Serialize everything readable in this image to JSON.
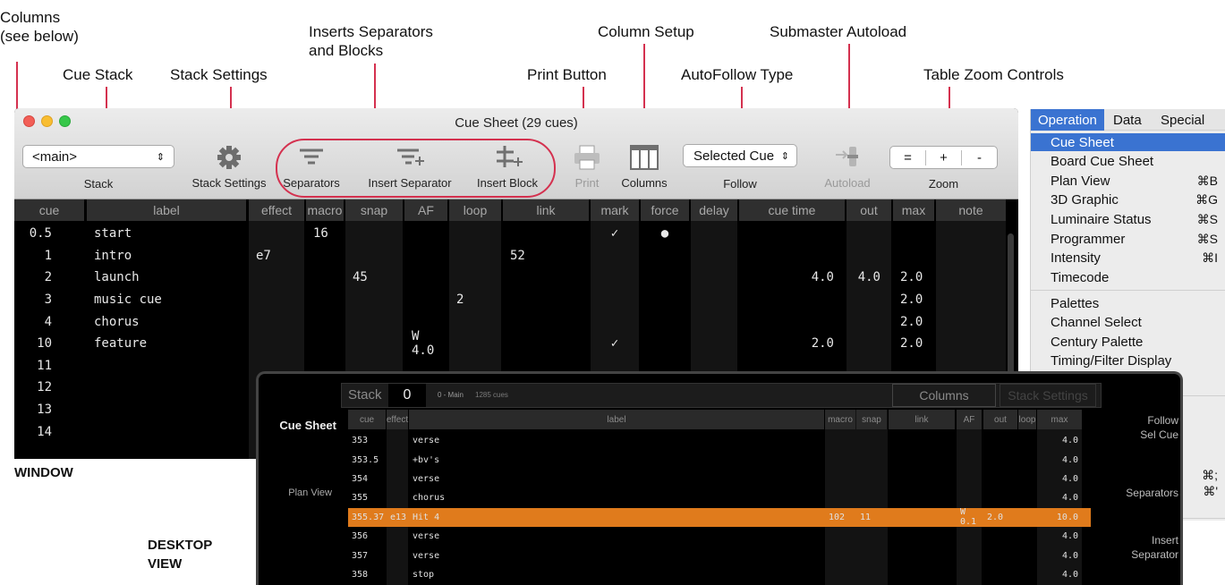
{
  "callouts": {
    "columns": "Columns\n(see below)",
    "cue_stack": "Cue Stack",
    "stack_settings": "Stack Settings",
    "inserts": "Inserts Separators\nand Blocks",
    "column_setup": "Column Setup",
    "submaster_autoload": "Submaster Autoload",
    "print_button": "Print Button",
    "autofollow_type": "AutoFollow Type",
    "table_zoom": "Table Zoom Controls",
    "window": "WINDOW",
    "desktop_view": "DESKTOP\nVIEW"
  },
  "colors": {
    "callout_line": "#d4314f",
    "highlight_row": "#e07b1c",
    "menu_selected": "#3a73d1"
  },
  "window": {
    "title": "Cue Sheet (29 cues)",
    "toolbar": {
      "stack_value": "<main>",
      "stack_label": "Stack",
      "stack_settings_label": "Stack Settings",
      "separators_label": "Separators",
      "insert_separator_label": "Insert Separator",
      "insert_block_label": "Insert Block",
      "print_label": "Print",
      "columns_label": "Columns",
      "follow_value": "Selected Cue",
      "follow_label": "Follow",
      "autoload_label": "Autoload",
      "zoom_label": "Zoom",
      "zoom_buttons": [
        "=",
        "+",
        "-"
      ],
      "icons": [
        "gear-icon",
        "separators-icon",
        "insert-separator-icon",
        "insert-block-icon",
        "printer-icon",
        "columns-icon",
        "autoload-icon"
      ]
    },
    "columns": [
      "cue",
      "label",
      "effect",
      "macro",
      "snap",
      "AF",
      "loop",
      "link",
      "mark",
      "force",
      "delay",
      "cue time",
      "out",
      "max",
      "note"
    ],
    "rows": [
      {
        "cue": "0.5",
        "label": "start",
        "effect": "",
        "macro": "16",
        "snap": "",
        "af": "",
        "loop": "",
        "link": "",
        "mark": "✓",
        "force": "●",
        "cuetime": "",
        "out": "",
        "max": ""
      },
      {
        "cue": "1",
        "label": "intro",
        "effect": "e7",
        "macro": "",
        "snap": "",
        "af": "",
        "loop": "",
        "link": "52",
        "mark": "",
        "force": "",
        "cuetime": "",
        "out": "",
        "max": ""
      },
      {
        "cue": "2",
        "label": "launch",
        "effect": "",
        "macro": "",
        "snap": "45",
        "af": "",
        "loop": "",
        "link": "",
        "mark": "",
        "force": "",
        "cuetime": "4.0",
        "out": "4.0",
        "max": "2.0"
      },
      {
        "cue": "3",
        "label": "music cue",
        "effect": "",
        "macro": "",
        "snap": "",
        "af": "",
        "loop": "2",
        "link": "",
        "mark": "",
        "force": "",
        "cuetime": "",
        "out": "",
        "max": "2.0"
      },
      {
        "cue": "4",
        "label": "chorus",
        "effect": "",
        "macro": "",
        "snap": "",
        "af": "",
        "loop": "",
        "link": "",
        "mark": "",
        "force": "",
        "cuetime": "",
        "out": "",
        "max": "2.0"
      },
      {
        "cue": "10",
        "label": "feature",
        "effect": "",
        "macro": "",
        "snap": "",
        "af": "W 4.0",
        "loop": "",
        "link": "",
        "mark": "✓",
        "force": "",
        "cuetime": "2.0",
        "out": "",
        "max": "2.0"
      },
      {
        "cue": "11",
        "label": "",
        "effect": "",
        "macro": "",
        "snap": "",
        "af": "",
        "loop": "",
        "link": "",
        "mark": "",
        "force": "",
        "cuetime": "",
        "out": "",
        "max": ""
      },
      {
        "cue": "12",
        "label": "",
        "effect": "",
        "macro": "",
        "snap": "",
        "af": "",
        "loop": "",
        "link": "",
        "mark": "",
        "force": "",
        "cuetime": "",
        "out": "",
        "max": ""
      },
      {
        "cue": "13",
        "label": "",
        "effect": "",
        "macro": "",
        "snap": "",
        "af": "",
        "loop": "",
        "link": "",
        "mark": "",
        "force": "",
        "cuetime": "",
        "out": "",
        "max": ""
      },
      {
        "cue": "14",
        "label": "",
        "effect": "",
        "macro": "",
        "snap": "",
        "af": "",
        "loop": "",
        "link": "",
        "mark": "",
        "force": "",
        "cuetime": "",
        "out": "",
        "max": ""
      }
    ]
  },
  "menu": {
    "bar": [
      "Operation",
      "Data",
      "Special"
    ],
    "items": [
      {
        "label": "Cue Sheet",
        "shortcut": ""
      },
      {
        "label": "Board Cue Sheet",
        "shortcut": ""
      },
      {
        "label": "Plan View",
        "shortcut": "⌘B"
      },
      {
        "label": "3D Graphic",
        "shortcut": "⌘G"
      },
      {
        "label": "Luminaire Status",
        "shortcut": "⌘S"
      },
      {
        "label": "Programmer",
        "shortcut": "⌘S"
      },
      {
        "label": "Intensity",
        "shortcut": "⌘I"
      },
      {
        "label": "Timecode",
        "shortcut": ""
      }
    ],
    "items2": [
      {
        "label": "Palettes"
      },
      {
        "label": "Channel Select"
      },
      {
        "label": "Century Palette"
      },
      {
        "label": "Timing/Filter Display"
      }
    ],
    "more_shortcuts": [
      "⌘;",
      "⌘'"
    ]
  },
  "desktop": {
    "stack_label": "Stack",
    "stack_value": "0",
    "stack_name": "0 - Main",
    "stack_count": "1285 cues",
    "columns_button": "Columns",
    "stack_settings_button": "Stack Settings",
    "nav": [
      "Cue Sheet",
      "Plan View"
    ],
    "right_buttons": [
      "Follow\nSel Cue",
      "Separators",
      "Insert\nSeparator"
    ],
    "columns": [
      "cue",
      "effect",
      "label",
      "macro",
      "snap",
      "link",
      "AF",
      "out",
      "loop",
      "max"
    ],
    "rows": [
      {
        "cue": "353",
        "effect": "",
        "label": "verse",
        "macro": "",
        "snap": "",
        "af": "",
        "out": "",
        "max": "4.0"
      },
      {
        "cue": "353.5",
        "effect": "",
        "label": "+bv's",
        "macro": "",
        "snap": "",
        "af": "",
        "out": "",
        "max": "4.0"
      },
      {
        "cue": "354",
        "effect": "",
        "label": "verse",
        "macro": "",
        "snap": "",
        "af": "",
        "out": "",
        "max": "4.0"
      },
      {
        "cue": "355",
        "effect": "",
        "label": "chorus",
        "macro": "",
        "snap": "",
        "af": "",
        "out": "",
        "max": "4.0"
      },
      {
        "cue": "355.37",
        "effect": "e13",
        "label": "Hit 4",
        "macro": "102",
        "snap": "11",
        "af": "W 0.1",
        "out": "2.0",
        "max": "10.0",
        "selected": true
      },
      {
        "cue": "356",
        "effect": "",
        "label": "verse",
        "macro": "",
        "snap": "",
        "af": "",
        "out": "",
        "max": "4.0"
      },
      {
        "cue": "357",
        "effect": "",
        "label": "verse",
        "macro": "",
        "snap": "",
        "af": "",
        "out": "",
        "max": "4.0"
      },
      {
        "cue": "358",
        "effect": "",
        "label": "stop",
        "macro": "",
        "snap": "",
        "af": "",
        "out": "",
        "max": "4.0"
      }
    ]
  }
}
